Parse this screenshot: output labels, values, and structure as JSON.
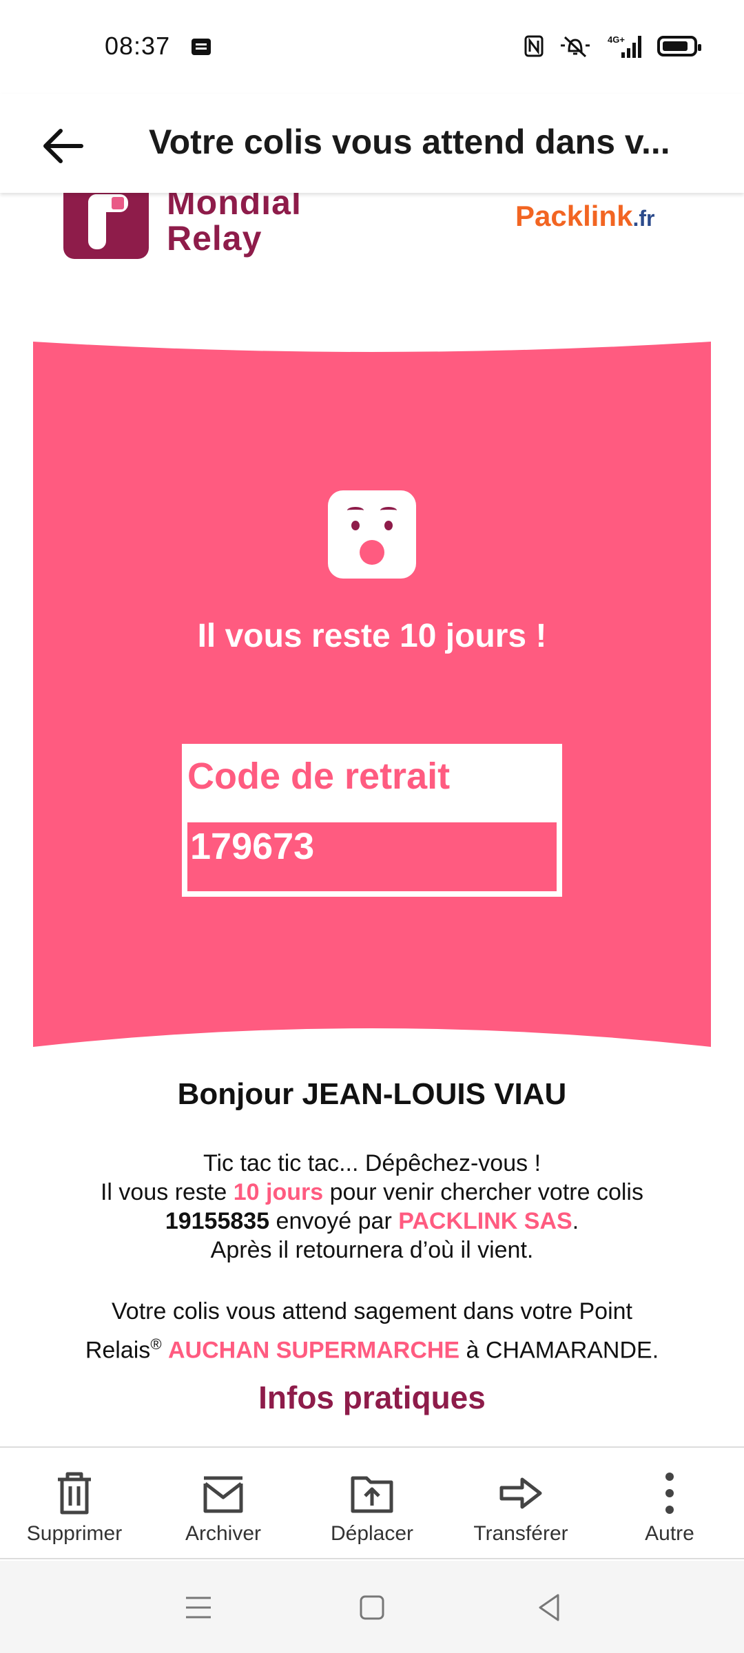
{
  "status_bar": {
    "time": "08:37",
    "network": "4G+"
  },
  "header": {
    "title": "Votre colis vous attend dans v..."
  },
  "email": {
    "brand_left": {
      "line1": "Mondial",
      "line2": "Relay"
    },
    "brand_right": {
      "name": "Packlink",
      "suffix": ".fr"
    },
    "banner": {
      "title": "Il vous reste 10 jours !",
      "code_label": "Code de retrait",
      "code_value": "179673"
    },
    "greeting": "Bonjour JEAN-LOUIS VIAU",
    "para1": {
      "line1": "Tic tac tic tac... Dépêchez-vous !",
      "line2_a": "Il vous reste ",
      "line2_days": "10 jours",
      "line2_b": " pour venir chercher votre colis",
      "parcel_number": "19155835",
      "line3_b": " envoyé par ",
      "sender": "PACKLINK SAS",
      "line3_end": ".",
      "line4": "Après il retournera d’où il vient."
    },
    "para2": {
      "line1": "Votre colis vous attend sagement dans votre Point",
      "relais": "Relais",
      "reg": "®",
      "store": "AUCHAN SUPERMARCHE",
      "city_text": " à CHAMARANDE."
    },
    "infos_title": "Infos pratiques"
  },
  "actions": [
    {
      "label": "Supprimer",
      "icon": "trash-icon"
    },
    {
      "label": "Archiver",
      "icon": "archive-icon"
    },
    {
      "label": "Déplacer",
      "icon": "move-icon"
    },
    {
      "label": "Transférer",
      "icon": "forward-icon"
    },
    {
      "label": "Autre",
      "icon": "more-icon"
    }
  ],
  "colors": {
    "pink": "#ff5b80",
    "brand_purple": "#8e1c4a",
    "packlink_orange": "#f26522"
  }
}
